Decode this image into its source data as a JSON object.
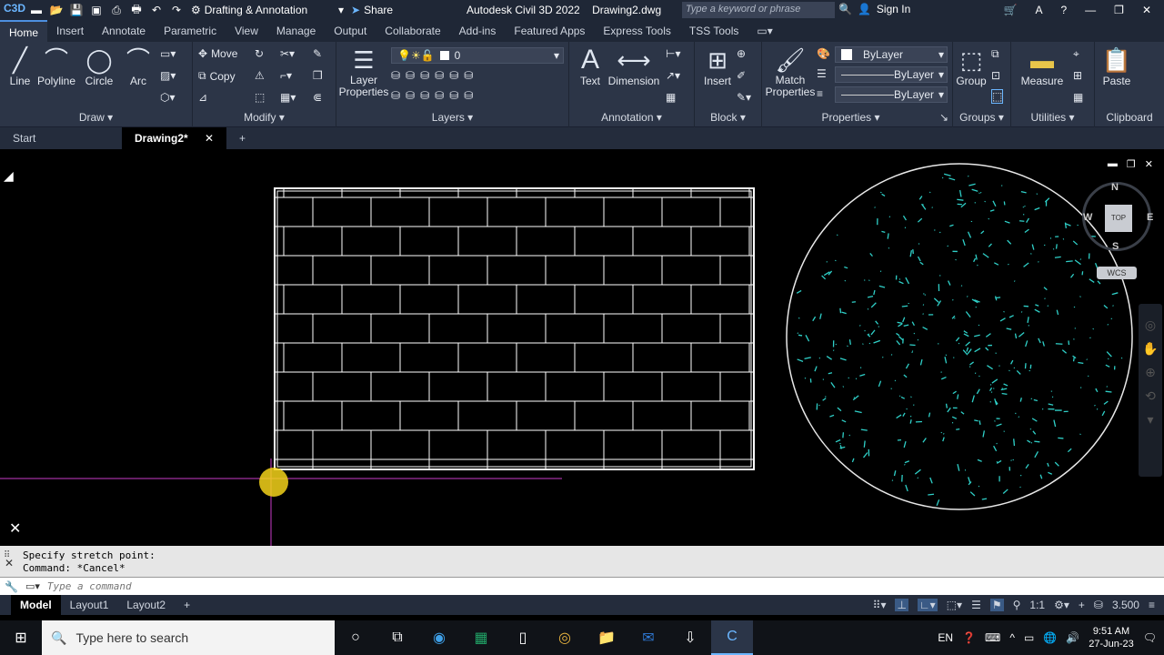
{
  "titlebar": {
    "workspace": "Drafting & Annotation",
    "share_label": "Share",
    "app_name": "Autodesk Civil 3D 2022",
    "doc_name": "Drawing2.dwg",
    "search_placeholder": "Type a keyword or phrase",
    "signin_label": "Sign In"
  },
  "ribbon_tabs": [
    "Home",
    "Insert",
    "Annotate",
    "Parametric",
    "View",
    "Manage",
    "Output",
    "Collaborate",
    "Add-ins",
    "Featured Apps",
    "Express Tools",
    "TSS Tools"
  ],
  "panels": {
    "draw": {
      "title": "Draw",
      "line": "Line",
      "polyline": "Polyline",
      "circle": "Circle",
      "arc": "Arc"
    },
    "modify": {
      "title": "Modify",
      "move": "Move",
      "copy": "Copy"
    },
    "layers": {
      "title": "Layers",
      "layer_properties_1": "Layer",
      "layer_properties_2": "Properties",
      "current_layer": "0"
    },
    "annotation": {
      "title": "Annotation",
      "text": "Text",
      "dimension": "Dimension"
    },
    "block": {
      "title": "Block",
      "insert": "Insert"
    },
    "properties": {
      "title": "Properties",
      "match_1": "Match",
      "match_2": "Properties",
      "color": "ByLayer",
      "linetype": "ByLayer",
      "lineweight": "ByLayer"
    },
    "groups": {
      "title": "Groups",
      "group": "Group"
    },
    "utilities": {
      "title": "Utilities",
      "measure": "Measure"
    },
    "clipboard": {
      "title": "Clipboard",
      "paste": "Paste"
    }
  },
  "doc_tabs": {
    "start": "Start",
    "active": "Drawing2*"
  },
  "viewcube": {
    "n": "N",
    "s": "S",
    "e": "E",
    "w": "W",
    "top": "TOP",
    "wcs": "WCS"
  },
  "command": {
    "history_1": "Specify stretch point:",
    "history_2": "Command: *Cancel*",
    "placeholder": "Type a command"
  },
  "layout_tabs": [
    "Model",
    "Layout1",
    "Layout2"
  ],
  "status": {
    "scale": "1:1",
    "annoscale": "3.500"
  },
  "taskbar": {
    "search_placeholder": "Type here to search",
    "lang": "EN",
    "time": "9:51 AM",
    "date": "27-Jun-23"
  },
  "colors": {
    "accent": "#4d8fe0",
    "ribbon_bg": "#2c3547",
    "title_bg": "#1f2736",
    "dots": "#2fd0c8",
    "crosshair": "#c83cc8",
    "cursor": "#f3d21a"
  }
}
